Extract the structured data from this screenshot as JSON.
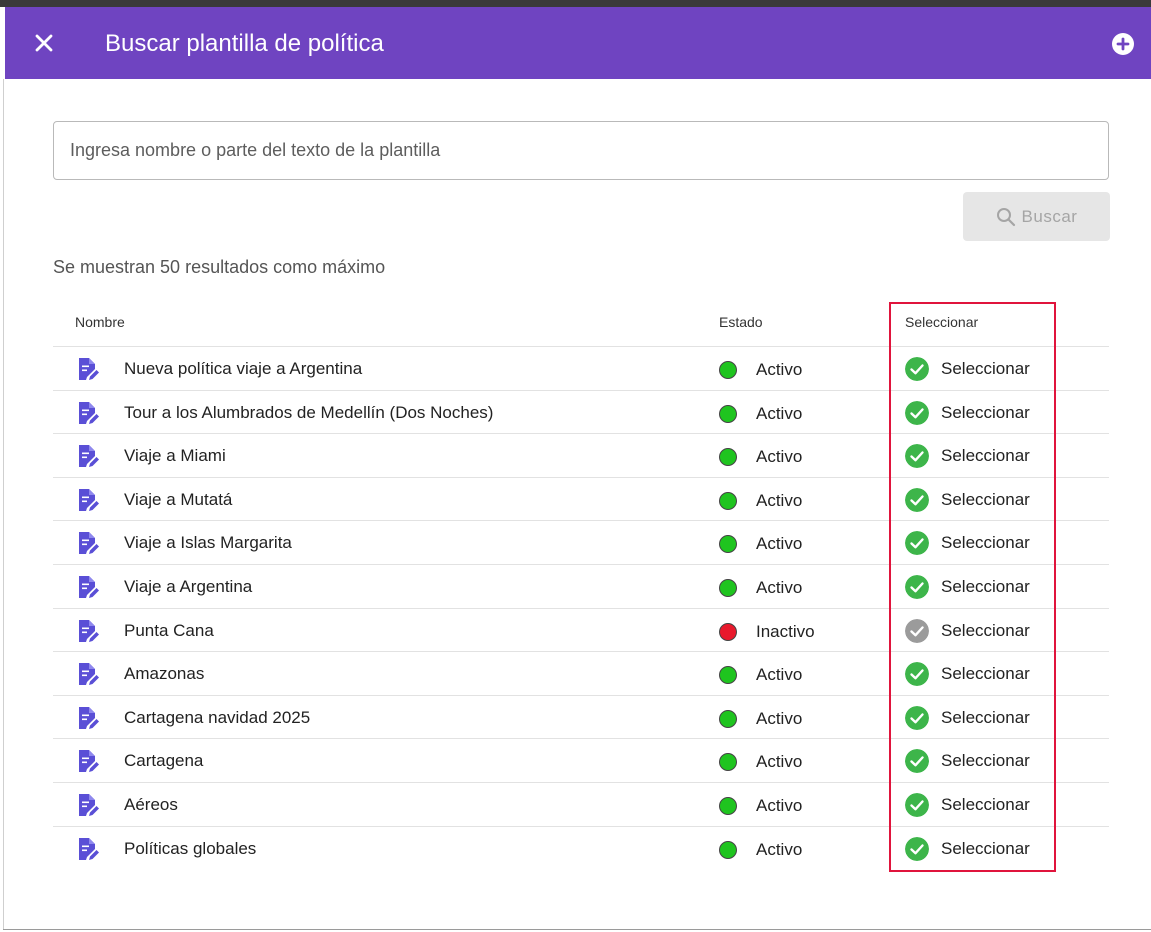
{
  "header": {
    "title": "Buscar plantilla de política"
  },
  "search": {
    "placeholder": "Ingresa nombre o parte del texto de la plantilla",
    "button_label": "Buscar"
  },
  "note": "Se muestran 50 resultados como máximo",
  "table": {
    "columns": {
      "name": "Nombre",
      "status": "Estado",
      "select": "Seleccionar"
    },
    "rows": [
      {
        "name": "Nueva política viaje a Argentina",
        "status": "Activo",
        "action": "Seleccionar"
      },
      {
        "name": "Tour a los Alumbrados de Medellín (Dos Noches)",
        "status": "Activo",
        "action": "Seleccionar"
      },
      {
        "name": "Viaje a Miami",
        "status": "Activo",
        "action": "Seleccionar"
      },
      {
        "name": "Viaje a Mutatá",
        "status": "Activo",
        "action": "Seleccionar"
      },
      {
        "name": "Viaje a Islas Margarita",
        "status": "Activo",
        "action": "Seleccionar"
      },
      {
        "name": "Viaje a Argentina",
        "status": "Activo",
        "action": "Seleccionar"
      },
      {
        "name": "Punta Cana",
        "status": "Inactivo",
        "action": "Seleccionar"
      },
      {
        "name": "Amazonas",
        "status": "Activo",
        "action": "Seleccionar"
      },
      {
        "name": "Cartagena navidad 2025",
        "status": "Activo",
        "action": "Seleccionar"
      },
      {
        "name": "Cartagena",
        "status": "Activo",
        "action": "Seleccionar"
      },
      {
        "name": "Aéreos",
        "status": "Activo",
        "action": "Seleccionar"
      },
      {
        "name": "Políticas globales",
        "status": "Activo",
        "action": "Seleccionar"
      }
    ]
  },
  "colors": {
    "header": "#6f44c1",
    "doc_icon": "#5a4fd6",
    "active": "#1fc41f",
    "inactive": "#e8192c",
    "select_enabled": "#3db54a",
    "select_disabled": "#9b9b9b",
    "highlight": "#e0143c"
  },
  "icons": {
    "close": "close-icon",
    "add": "add-circle-icon",
    "search": "search-icon",
    "row": "document-edit-icon",
    "select_enabled": "check-circle-icon",
    "select_disabled": "check-circle-icon"
  }
}
